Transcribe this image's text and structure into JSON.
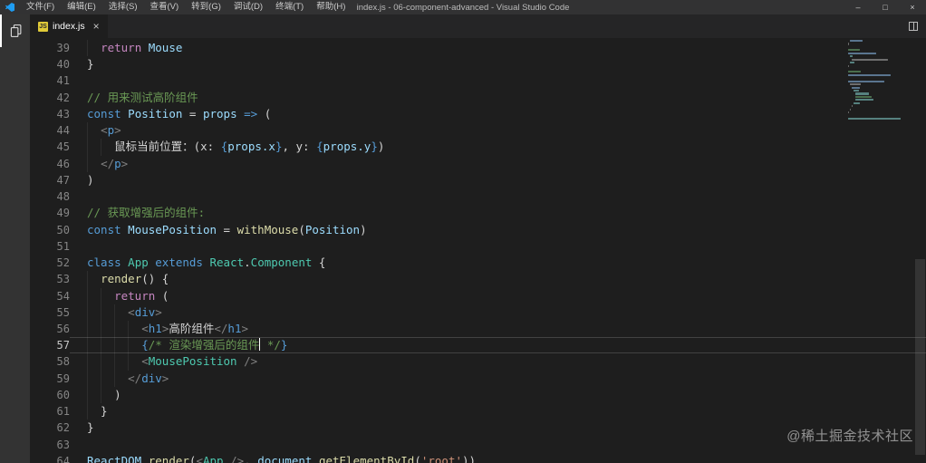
{
  "window": {
    "title": "index.js - 06-component-advanced - Visual Studio Code",
    "menus": [
      "文件(F)",
      "编辑(E)",
      "选择(S)",
      "查看(V)",
      "转到(G)",
      "调试(D)",
      "终端(T)",
      "帮助(H)"
    ],
    "controls": {
      "minimize": "–",
      "maximize": "□",
      "close": "×"
    }
  },
  "tab_bar": {
    "active_tab": {
      "label": "index.js",
      "file_badge": "JS",
      "close": "×"
    }
  },
  "editor": {
    "language": "javascript",
    "current_line": 57,
    "lines": [
      {
        "n": 39,
        "segs": [
          [
            "  ",
            "d"
          ],
          [
            "return",
            "ctrl"
          ],
          [
            " ",
            "d"
          ],
          [
            "Mouse",
            "var"
          ]
        ]
      },
      {
        "n": 40,
        "segs": [
          [
            "}",
            "d"
          ]
        ]
      },
      {
        "n": 41,
        "segs": []
      },
      {
        "n": 42,
        "segs": [
          [
            "// 用来测试高阶组件",
            "com"
          ]
        ]
      },
      {
        "n": 43,
        "segs": [
          [
            "const",
            "kw"
          ],
          [
            " ",
            "d"
          ],
          [
            "Position",
            "var"
          ],
          [
            " = ",
            "d"
          ],
          [
            "props",
            "var"
          ],
          [
            " ",
            "d"
          ],
          [
            "=>",
            "kw"
          ],
          [
            " (",
            "d"
          ]
        ]
      },
      {
        "n": 44,
        "segs": [
          [
            "  ",
            "d"
          ],
          [
            "<",
            "punct"
          ],
          [
            "p",
            "tag"
          ],
          [
            ">",
            "punct"
          ]
        ]
      },
      {
        "n": 45,
        "segs": [
          [
            "    ",
            "d"
          ],
          [
            "鼠标当前位置：(x: ",
            "d"
          ],
          [
            "{",
            "brace"
          ],
          [
            "props.x",
            "var"
          ],
          [
            "}",
            "brace"
          ],
          [
            ", y: ",
            "d"
          ],
          [
            "{",
            "brace"
          ],
          [
            "props.y",
            "var"
          ],
          [
            "}",
            "brace"
          ],
          [
            ")",
            "d"
          ]
        ]
      },
      {
        "n": 46,
        "segs": [
          [
            "  ",
            "d"
          ],
          [
            "</",
            "punct"
          ],
          [
            "p",
            "tag"
          ],
          [
            ">",
            "punct"
          ]
        ]
      },
      {
        "n": 47,
        "segs": [
          [
            ")",
            "d"
          ]
        ]
      },
      {
        "n": 48,
        "segs": []
      },
      {
        "n": 49,
        "segs": [
          [
            "// 获取增强后的组件:",
            "com"
          ]
        ]
      },
      {
        "n": 50,
        "segs": [
          [
            "const",
            "kw"
          ],
          [
            " ",
            "d"
          ],
          [
            "MousePosition",
            "var"
          ],
          [
            " = ",
            "d"
          ],
          [
            "withMouse",
            "func"
          ],
          [
            "(",
            "d"
          ],
          [
            "Position",
            "var"
          ],
          [
            ")",
            "d"
          ]
        ]
      },
      {
        "n": 51,
        "segs": []
      },
      {
        "n": 52,
        "segs": [
          [
            "class",
            "kw"
          ],
          [
            " ",
            "d"
          ],
          [
            "App",
            "type"
          ],
          [
            " ",
            "d"
          ],
          [
            "extends",
            "kw"
          ],
          [
            " ",
            "d"
          ],
          [
            "React",
            "type"
          ],
          [
            ".",
            "d"
          ],
          [
            "Component",
            "type"
          ],
          [
            " {",
            "d"
          ]
        ]
      },
      {
        "n": 53,
        "segs": [
          [
            "  ",
            "d"
          ],
          [
            "render",
            "func"
          ],
          [
            "() {",
            "d"
          ]
        ]
      },
      {
        "n": 54,
        "segs": [
          [
            "    ",
            "d"
          ],
          [
            "return",
            "ctrl"
          ],
          [
            " (",
            "d"
          ]
        ]
      },
      {
        "n": 55,
        "segs": [
          [
            "      ",
            "d"
          ],
          [
            "<",
            "punct"
          ],
          [
            "div",
            "tag"
          ],
          [
            ">",
            "punct"
          ]
        ]
      },
      {
        "n": 56,
        "segs": [
          [
            "        ",
            "d"
          ],
          [
            "<",
            "punct"
          ],
          [
            "h1",
            "tag"
          ],
          [
            ">",
            "punct"
          ],
          [
            "高阶组件",
            "d"
          ],
          [
            "</",
            "punct"
          ],
          [
            "h1",
            "tag"
          ],
          [
            ">",
            "punct"
          ]
        ]
      },
      {
        "n": 57,
        "segs": [
          [
            "        ",
            "d"
          ],
          [
            "{",
            "brace"
          ],
          [
            "/* 渲染增强后的组件",
            "com"
          ],
          [
            "",
            "cursor"
          ],
          [
            " */",
            "com"
          ],
          [
            "}",
            "brace"
          ]
        ]
      },
      {
        "n": 58,
        "segs": [
          [
            "        ",
            "d"
          ],
          [
            "<",
            "punct"
          ],
          [
            "MousePosition",
            "type"
          ],
          [
            " />",
            "punct"
          ]
        ]
      },
      {
        "n": 59,
        "segs": [
          [
            "      ",
            "d"
          ],
          [
            "</",
            "punct"
          ],
          [
            "div",
            "tag"
          ],
          [
            ">",
            "punct"
          ]
        ]
      },
      {
        "n": 60,
        "segs": [
          [
            "    )",
            "d"
          ]
        ]
      },
      {
        "n": 61,
        "segs": [
          [
            "  }",
            "d"
          ]
        ]
      },
      {
        "n": 62,
        "segs": [
          [
            "}",
            "d"
          ]
        ]
      },
      {
        "n": 63,
        "segs": []
      },
      {
        "n": 64,
        "segs": [
          [
            "ReactDOM",
            "var"
          ],
          [
            ".",
            "d"
          ],
          [
            "render",
            "func"
          ],
          [
            "(",
            "d"
          ],
          [
            "<",
            "punct"
          ],
          [
            "App",
            "type"
          ],
          [
            " ",
            "d"
          ],
          [
            "/>",
            "punct"
          ],
          [
            ", ",
            "d"
          ],
          [
            "document",
            "var"
          ],
          [
            ".",
            "d"
          ],
          [
            "getElementById",
            "func"
          ],
          [
            "(",
            "d"
          ],
          [
            "'root'",
            "str"
          ],
          [
            "))",
            "d"
          ]
        ]
      }
    ]
  },
  "watermark": "@稀土掘金技术社区",
  "colors": {
    "background": "#1e1e1e",
    "titlebar": "#323233",
    "activitybar": "#333333",
    "tabbar": "#252526",
    "keyword_blue": "#569cd6",
    "keyword_purple": "#c586c0",
    "variable_blue": "#9cdcfe",
    "function_yellow": "#dcdcaa",
    "type_teal": "#4ec9b0",
    "comment_green": "#6a9955",
    "string_orange": "#ce9178",
    "logo_blue": "#1f9cf0"
  }
}
